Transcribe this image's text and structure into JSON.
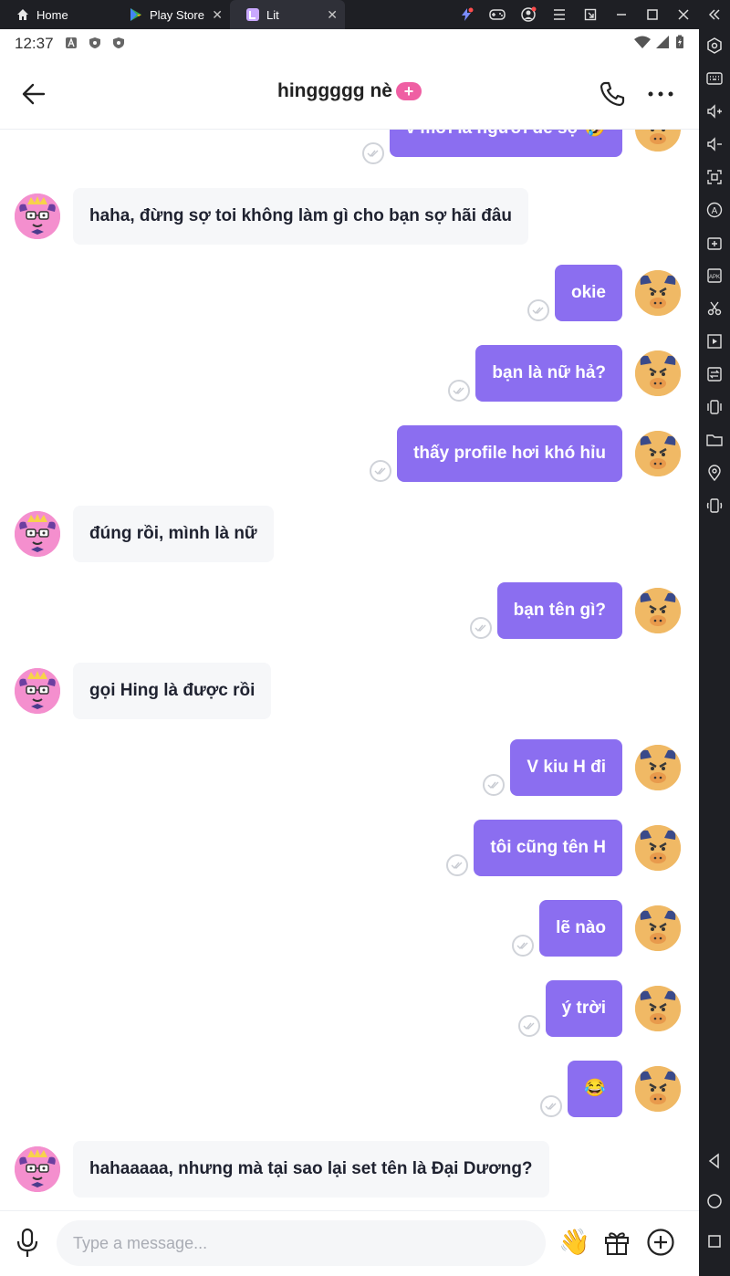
{
  "window": {
    "tabs": [
      {
        "label": "Home"
      },
      {
        "label": "Play Store"
      },
      {
        "label": "Lit"
      }
    ]
  },
  "status_bar": {
    "time": "12:37"
  },
  "chat_header": {
    "title": "hinggggg nè",
    "badge": "+"
  },
  "messages": [
    {
      "side": "out",
      "text": "v mới là người dễ sợ 🤣"
    },
    {
      "side": "in",
      "text": "haha, đừng sợ  toi không làm gì cho bạn sợ hãi đâu"
    },
    {
      "side": "out",
      "text": "okie"
    },
    {
      "side": "out",
      "text": "bạn là nữ hả?"
    },
    {
      "side": "out",
      "text": "thấy profile hơi khó hỉu"
    },
    {
      "side": "in",
      "text": "đúng rồi, mình là nữ"
    },
    {
      "side": "out",
      "text": "bạn tên gì?"
    },
    {
      "side": "in",
      "text": "gọi Hing là được rồi"
    },
    {
      "side": "out",
      "text": "V kiu H đi"
    },
    {
      "side": "out",
      "text": "tôi cũng tên H"
    },
    {
      "side": "out",
      "text": "lẽ nào"
    },
    {
      "side": "out",
      "text": "ý trời"
    },
    {
      "side": "out",
      "text": "😂"
    },
    {
      "side": "in",
      "text": "hahaaaaa, nhưng mà tại sao lại set tên là Đại Dương?"
    }
  ],
  "composer": {
    "placeholder": "Type a message...",
    "wave_emoji": "👋"
  },
  "colors": {
    "outgoing_bubble": "#8b6ef0",
    "incoming_bubble": "#f6f7f9",
    "badge": "#ef5fa3"
  }
}
